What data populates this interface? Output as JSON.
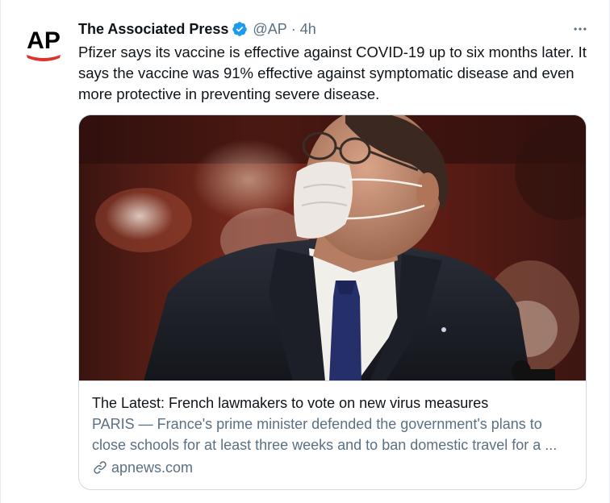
{
  "author": {
    "display_name": "The Associated Press",
    "handle": "@AP",
    "separator": "·",
    "timestamp": "4h",
    "verified": true,
    "avatar_text": "AP",
    "avatar_text_color": "#000000",
    "avatar_accent_color": "#e0322b"
  },
  "tweet": {
    "text": "Pfizer says its vaccine is effective against COVID-19 up to six months later. It says the vaccine was 91% effective against symptomatic disease and even more protective in preventing severe disease."
  },
  "card": {
    "image_icon": "photo-man-in-face-mask",
    "title": "The Latest: French lawmakers to vote on new virus measures",
    "description_line1": "PARIS — France's prime minister defended the government's plans to",
    "description_line2": "close schools for at least three weeks and to ban domestic travel for a ...",
    "domain": "apnews.com"
  },
  "icons": {
    "verified": "verified-badge-icon",
    "more": "more-options-icon",
    "link": "link-icon"
  },
  "colors": {
    "verified_blue": "#1d9bf0",
    "secondary_text": "#5b7083",
    "primary_text": "#0f1419",
    "card_border": "#cfd9de"
  }
}
